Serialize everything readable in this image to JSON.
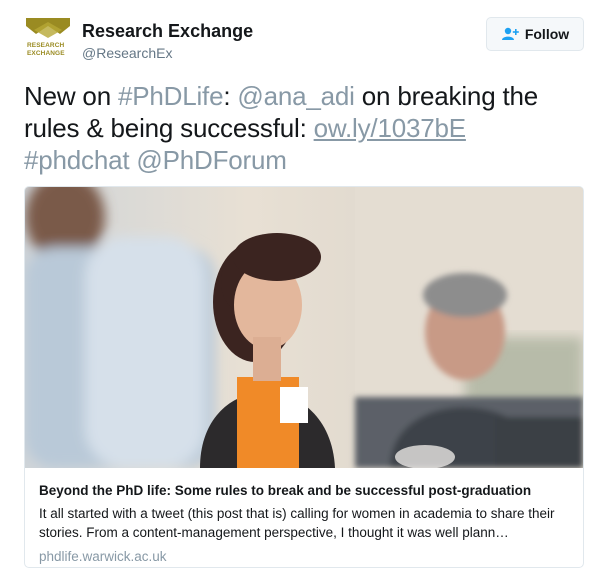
{
  "account": {
    "display_name": "Research Exchange",
    "handle": "@ResearchEx",
    "logo_line1": "RESEARCH",
    "logo_line2": "EXCHANGE",
    "logo_color": "#9a8b22"
  },
  "follow_button": {
    "label": "Follow",
    "icon": "add-user-icon"
  },
  "tweet": {
    "text_1": "New on ",
    "hashtag_1": "#PhDLife",
    "text_2": ": ",
    "mention_1": "@ana_adi",
    "text_3": " on breaking the rules  & being successful: ",
    "url": "ow.ly/1037bE",
    "hashtag_2": "#phdchat",
    "mention_2": "@PhDForum"
  },
  "card": {
    "image_alt": "photo",
    "title": "Beyond the PhD life: Some rules to break and be successful post-graduation",
    "description": "It all started with a tweet (this post that is) calling for women in academia to share their stories. From a content-management perspective, I thought it was well plann…",
    "domain": "phdlife.warwick.ac.uk"
  },
  "colors": {
    "link": "#8899a6",
    "text": "#14171a",
    "muted": "#657786",
    "border": "#e1e8ed"
  }
}
